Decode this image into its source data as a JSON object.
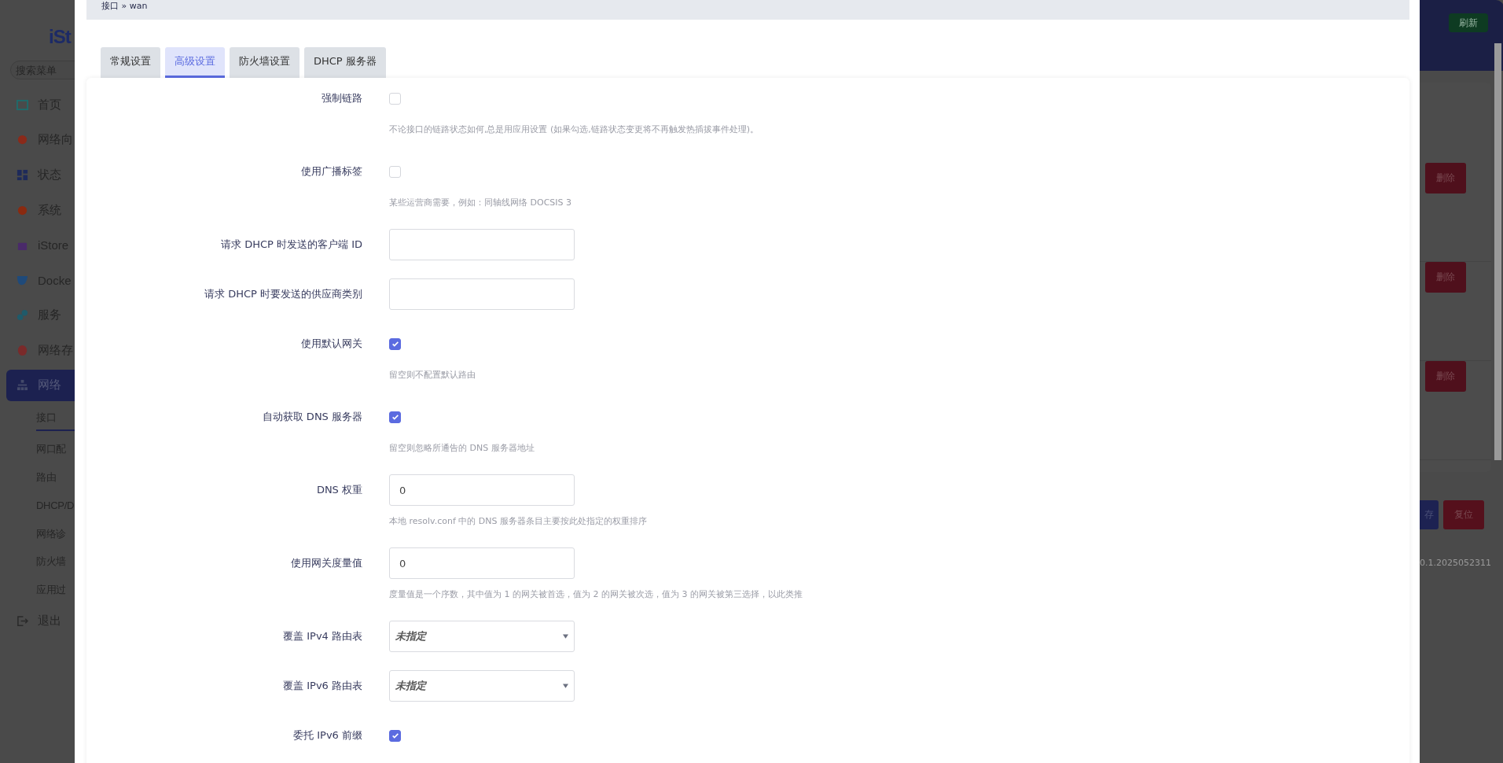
{
  "sidebar": {
    "logo": "iSt",
    "search": {
      "placeholder": "搜索菜单"
    },
    "items": [
      {
        "label": "首页",
        "selected": false
      },
      {
        "label": "网络向",
        "selected": false
      },
      {
        "label": "状态",
        "selected": false
      },
      {
        "label": "系统",
        "selected": false
      },
      {
        "label": "iStore",
        "selected": false
      },
      {
        "label": "Docke",
        "selected": false
      },
      {
        "label": "服务",
        "selected": false
      },
      {
        "label": "网络存",
        "selected": false
      },
      {
        "label": "网络",
        "selected": true
      }
    ],
    "subitems": [
      {
        "label": "接口",
        "selected": true
      },
      {
        "label": "网口配",
        "selected": false
      },
      {
        "label": "路由",
        "selected": false
      },
      {
        "label": "DHCP/D",
        "selected": false
      },
      {
        "label": "网络诊",
        "selected": false
      },
      {
        "label": "防火墙",
        "selected": false
      },
      {
        "label": "应用过",
        "selected": false
      }
    ],
    "logout": "退出"
  },
  "modal": {
    "breadcrumb": "接口 » wan",
    "tabs": [
      {
        "label": "常规设置",
        "selected": false
      },
      {
        "label": "高级设置",
        "selected": true
      },
      {
        "label": "防火墙设置",
        "selected": false
      },
      {
        "label": "DHCP 服务器",
        "selected": false
      }
    ],
    "fields": [
      {
        "kind": "checkbox",
        "label": "强制链路",
        "checked": false,
        "hint": "不论接口的链路状态如何,总是用应用设置 (如果勾选,链路状态变更将不再触发热插拔事件处理)。"
      },
      {
        "kind": "checkbox",
        "label": "使用广播标签",
        "checked": false,
        "hint": "某些运营商需要，例如：同轴线网络 DOCSIS 3"
      },
      {
        "kind": "text",
        "label": "请求 DHCP 时发送的客户端 ID"
      },
      {
        "kind": "text",
        "label": "请求 DHCP 时要发送的供应商类别"
      },
      {
        "kind": "checkbox",
        "label": "使用默认网关",
        "checked": true,
        "hint": "留空则不配置默认路由"
      },
      {
        "kind": "checkbox",
        "label": "自动获取 DNS 服务器",
        "checked": true,
        "hint": "留空则忽略所通告的 DNS 服务器地址"
      },
      {
        "kind": "text",
        "label": "DNS 权重",
        "value": "0",
        "hint": "本地 resolv.conf 中的 DNS 服务器条目主要按此处指定的权重排序"
      },
      {
        "kind": "text",
        "label": "使用网关度量值",
        "value": "0",
        "hint": "度量值是一个序数，其中值为 1 的网关被首选，值为 2 的网关被次选，值为 3 的网关被第三选择，以此类推"
      },
      {
        "kind": "select",
        "label": "覆盖 IPv4 路由表",
        "value": "未指定"
      },
      {
        "kind": "select",
        "label": "覆盖 IPv6 路由表",
        "value": "未指定"
      },
      {
        "kind": "checkbox",
        "label": "委托 IPv6 前缀",
        "checked": true
      }
    ]
  },
  "background": {
    "refresh_button": "刷新",
    "delete_buttons": [
      "删除",
      "删除",
      "删除"
    ],
    "save_button": "存",
    "reset_button": "复位",
    "version": "0.1.2025052311"
  }
}
